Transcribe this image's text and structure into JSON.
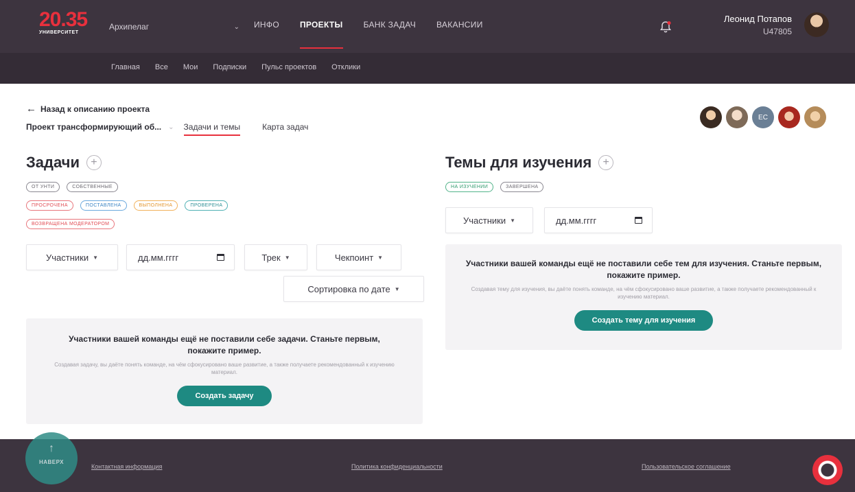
{
  "header": {
    "logo_number": "20.35",
    "logo_sub": "УНИВЕРСИТЕТ",
    "org_select": "Архипелаг",
    "nav": [
      "ИНФО",
      "ПРОЕКТЫ",
      "БАНК ЗАДАЧ",
      "ВАКАНСИИ"
    ],
    "active_nav": "ПРОЕКТЫ",
    "user_name": "Леонид Потапов",
    "user_id": "U47805"
  },
  "subnav": [
    "Главная",
    "Все",
    "Мои",
    "Подписки",
    "Пульс проектов",
    "Отклики"
  ],
  "page": {
    "back_link": "Назад к описанию проекта",
    "project_name": "Проект трансформирующий об...",
    "tabs": [
      "Задачи и темы",
      "Карта задач"
    ],
    "active_tab": "Задачи и темы",
    "team_initials": "ЕС"
  },
  "tasks": {
    "title": "Задачи",
    "tags_row1": [
      "от УНТИ",
      "собственные"
    ],
    "tags_row2": [
      "просрочена",
      "поставлена",
      "выполнена",
      "проверена"
    ],
    "tags_row3": [
      "возвращена модератором"
    ],
    "filter_participants": "Участники",
    "date_placeholder": "дд.мм.гггг",
    "filter_track": "Трек",
    "filter_checkpoint": "Чекпоинт",
    "sort": "Сортировка по дате",
    "empty_heading": "Участники вашей команды ещё не поставили себе задачи. Станьте первым, покажите пример.",
    "empty_text": "Создавая задачу, вы даёте понять команде, на чём сфокусировано ваше развитие, а также получаете рекомендованный к изучению материал.",
    "create_button": "Создать задачу"
  },
  "topics": {
    "title": "Темы для изучения",
    "tags": [
      "на изучении",
      "завершена"
    ],
    "filter_participants": "Участники",
    "date_placeholder": "дд.мм.гггг",
    "empty_heading": "Участники вашей команды ещё не поставили себе тем для изучения. Станьте первым, покажите пример.",
    "empty_text": "Создавая тему для изучения, вы даёте понять команде, на чём сфокусировано ваше развитие, а также получаете рекомендованный к изучению материал.",
    "create_button": "Создать тему для изучения"
  },
  "footer": {
    "to_top": "НАВЕРХ",
    "contacts": "Контактная информация",
    "privacy": "Политика конфиденциальности",
    "agreement": "Пользовательское соглашение"
  },
  "colors": {
    "accent_red": "#e8303d",
    "primary_teal": "#1e8a82",
    "header_bg": "#3d343f"
  }
}
